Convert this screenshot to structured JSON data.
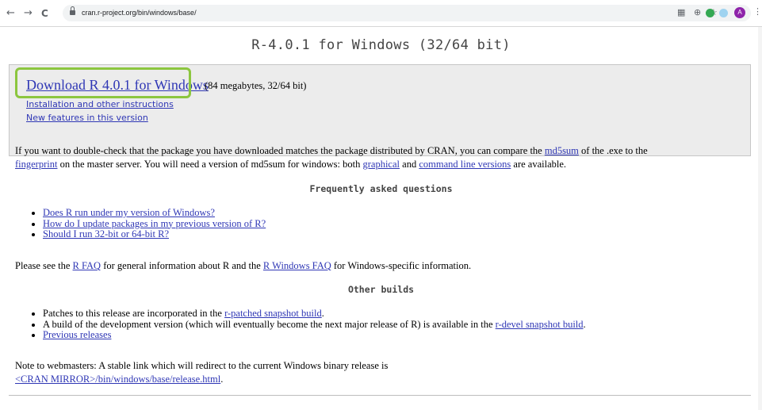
{
  "browser": {
    "url": "cran.r-project.org/bin/windows/base/",
    "back_glyph": "←",
    "forward_glyph": "→",
    "reload_glyph": "C",
    "avatar_letter": "A",
    "menu_glyph": "⋮",
    "star_glyph": "☆",
    "zoom_glyph": "⊕"
  },
  "page": {
    "title": "R-4.0.1 for Windows (32/64 bit)",
    "download": {
      "link_label": "Download R 4.0.1 for Windows",
      "note": "(84 megabytes, 32/64 bit)",
      "install_link": "Installation and other instructions",
      "features_link": "New features in this version"
    },
    "checksum": {
      "line1_a": "If you want to double-check that the package you have downloaded matches the package distributed by CRAN, you can compare the ",
      "md5_link": "md5sum",
      "line1_b": " of the .exe to the",
      "fingerprint_link": "fingerprint",
      "line2_a": " on the master server. You will need a version of md5sum for windows: both ",
      "graphical_link": "graphical",
      "line2_b": " and ",
      "cmdline_link": "command line versions",
      "line2_c": " are available."
    },
    "faq_heading": "Frequently asked questions",
    "faq_items": [
      "Does R run under my version of Windows?",
      "How do I update packages in my previous version of R?",
      "Should I run 32-bit or 64-bit R?"
    ],
    "faq_para": {
      "a": "Please see the ",
      "rfaq_link": "R FAQ",
      "b": " for general information about R and the ",
      "rwinfaq_link": "R Windows FAQ",
      "c": " for Windows-specific information."
    },
    "builds_heading": "Other builds",
    "builds": {
      "item1_a": "Patches to this release are incorporated in the ",
      "item1_link": "r-patched snapshot build",
      "item1_b": ".",
      "item2_a": "A build of the development version (which will eventually become the next major release of R) is available in the ",
      "item2_link": "r-devel snapshot build",
      "item2_b": ".",
      "item3_link": "Previous releases"
    },
    "webmasters": {
      "line1": "Note to webmasters: A stable link which will redirect to the current Windows binary release is",
      "link": "<CRAN MIRROR>/bin/windows/base/release.html",
      "tail": "."
    }
  }
}
